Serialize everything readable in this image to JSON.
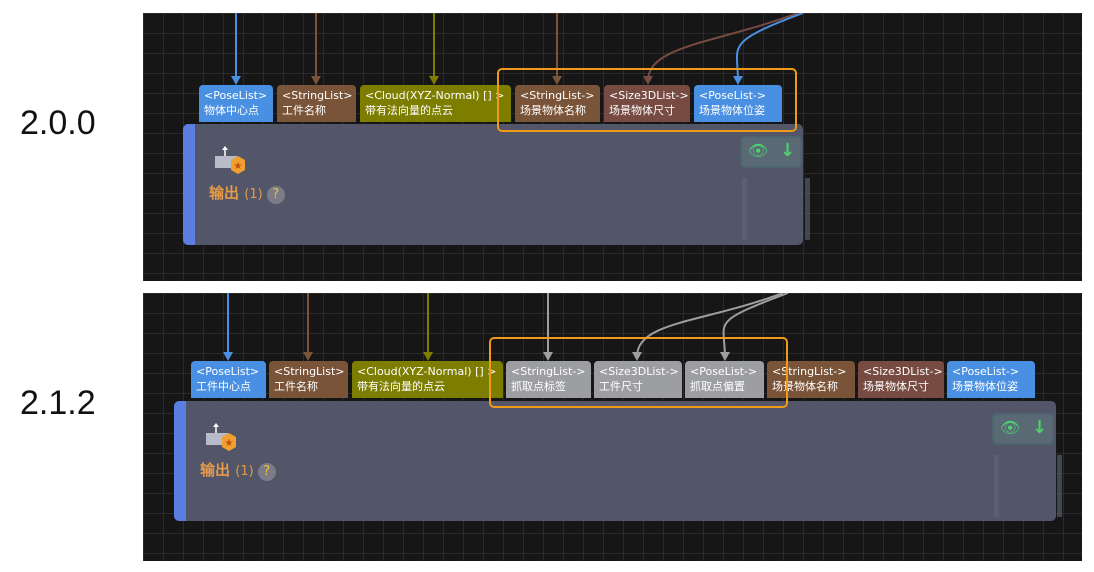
{
  "versions": [
    {
      "label": "2.0.0",
      "node": {
        "output_label": "输出",
        "output_count": "(1)",
        "help": "?"
      },
      "ports": [
        {
          "type": "<PoseList>",
          "name": "物体中心点",
          "color": "#4a90e2"
        },
        {
          "type": "<StringList>",
          "name": "工件名称",
          "color": "#7a5438"
        },
        {
          "type": "<Cloud(XYZ-Normal) [] >",
          "name": "带有法向量的点云",
          "color": "#7d7d00"
        },
        {
          "type": "<StringList->",
          "name": "场景物体名称",
          "color": "#7a5438"
        },
        {
          "type": "<Size3DList->",
          "name": "场景物体尺寸",
          "color": "#774a42"
        },
        {
          "type": "<PoseList->",
          "name": "场景物体位姿",
          "color": "#4a90e2"
        }
      ]
    },
    {
      "label": "2.1.2",
      "node": {
        "output_label": "输出",
        "output_count": "(1)",
        "help": "?"
      },
      "ports": [
        {
          "type": "<PoseList>",
          "name": "工件中心点",
          "color": "#4a90e2"
        },
        {
          "type": "<StringList>",
          "name": "工件名称",
          "color": "#7a5438"
        },
        {
          "type": "<Cloud(XYZ-Normal) [] >",
          "name": "带有法向量的点云",
          "color": "#7d7d00"
        },
        {
          "type": "<StringList->",
          "name": "抓取点标签",
          "color": "#9d9ea2"
        },
        {
          "type": "<Size3DList->",
          "name": "工件尺寸",
          "color": "#9d9ea2"
        },
        {
          "type": "<PoseList->",
          "name": "抓取点偏置",
          "color": "#9d9ea2"
        },
        {
          "type": "<StringList->",
          "name": "场景物体名称",
          "color": "#7a5438"
        },
        {
          "type": "<Size3DList->",
          "name": "场景物体尺寸",
          "color": "#774a42"
        },
        {
          "type": "<PoseList->",
          "name": "场景物体位姿",
          "color": "#4a90e2"
        }
      ]
    }
  ],
  "colors": {
    "highlight": "#f09a1a",
    "node_bg": "#535568",
    "node_accent": "#5a7fe0",
    "output_text": "#e39a4a"
  }
}
